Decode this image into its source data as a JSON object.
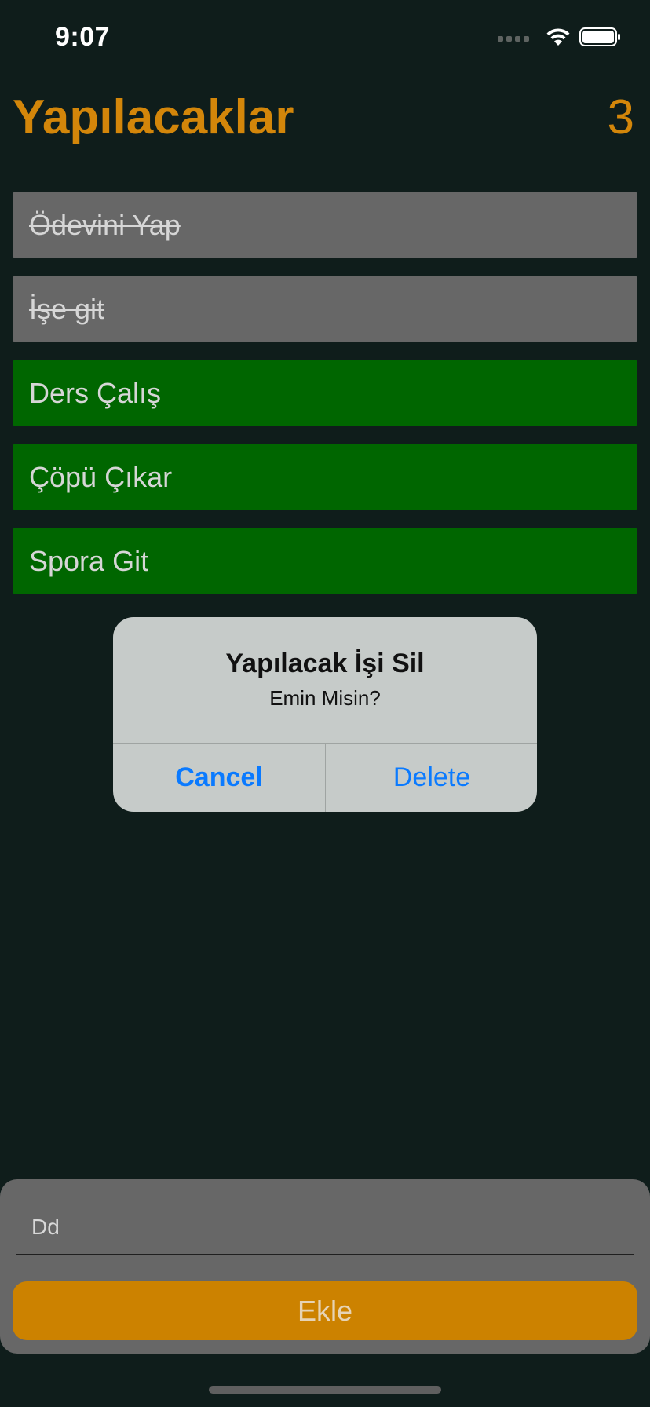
{
  "status_bar": {
    "time": "9:07",
    "wifi_icon": "wifi-icon",
    "battery_icon": "battery-icon",
    "signal_icon": "signal-dots-icon"
  },
  "header": {
    "title": "Yapılacaklar",
    "count": "3"
  },
  "todos": [
    {
      "text": "Ödevini Yap",
      "completed": true
    },
    {
      "text": "İşe git",
      "completed": true
    },
    {
      "text": "Ders Çalış",
      "completed": false
    },
    {
      "text": "Çöpü Çıkar",
      "completed": false
    },
    {
      "text": "Spora Git",
      "completed": false
    }
  ],
  "alert": {
    "title": "Yapılacak İşi Sil",
    "message": "Emin Misin?",
    "cancel_label": "Cancel",
    "delete_label": "Delete"
  },
  "input": {
    "value": "Dd"
  },
  "add_button": {
    "label": "Ekle"
  },
  "colors": {
    "background": "#0f1d1b",
    "accent": "#d3860a",
    "done_item": "#676767",
    "pending_item": "#006600",
    "alert_button": "#0a7aff"
  }
}
